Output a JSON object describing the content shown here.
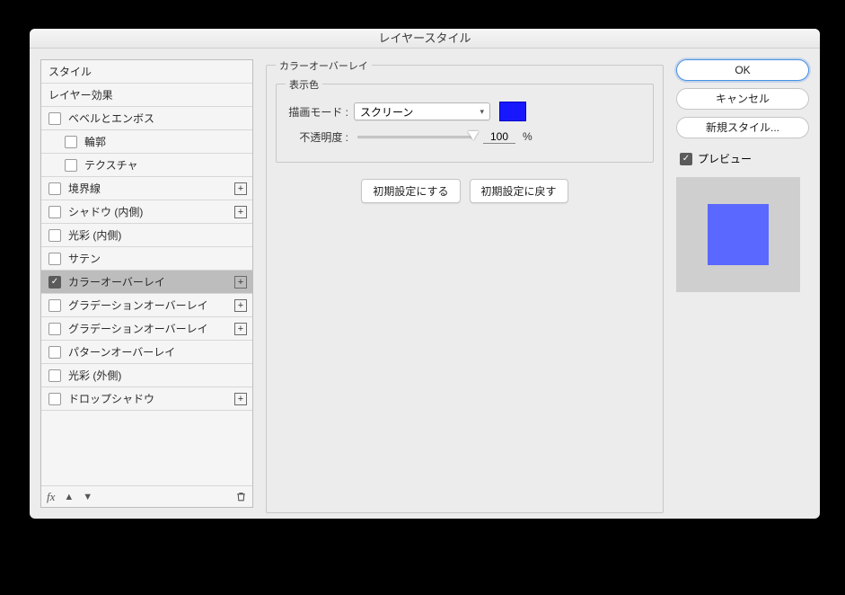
{
  "window": {
    "title": "レイヤースタイル"
  },
  "sidebar": {
    "header_styles": "スタイル",
    "header_effects": "レイヤー効果",
    "items": [
      {
        "label": "ベベルとエンボス",
        "checked": false,
        "has_add": false,
        "indent": 1
      },
      {
        "label": "輪郭",
        "checked": false,
        "has_add": false,
        "indent": 2
      },
      {
        "label": "テクスチャ",
        "checked": false,
        "has_add": false,
        "indent": 2
      },
      {
        "label": "境界線",
        "checked": false,
        "has_add": true,
        "indent": 1
      },
      {
        "label": "シャドウ (内側)",
        "checked": false,
        "has_add": true,
        "indent": 1
      },
      {
        "label": "光彩 (内側)",
        "checked": false,
        "has_add": false,
        "indent": 1
      },
      {
        "label": "サテン",
        "checked": false,
        "has_add": false,
        "indent": 1
      },
      {
        "label": "カラーオーバーレイ",
        "checked": true,
        "has_add": true,
        "indent": 1,
        "selected": true
      },
      {
        "label": "グラデーションオーバーレイ",
        "checked": false,
        "has_add": true,
        "indent": 1
      },
      {
        "label": "グラデーションオーバーレイ",
        "checked": false,
        "has_add": true,
        "indent": 1
      },
      {
        "label": "パターンオーバーレイ",
        "checked": false,
        "has_add": false,
        "indent": 1
      },
      {
        "label": "光彩 (外側)",
        "checked": false,
        "has_add": false,
        "indent": 1
      },
      {
        "label": "ドロップシャドウ",
        "checked": false,
        "has_add": true,
        "indent": 1
      }
    ],
    "footer": {
      "fx": "fx"
    }
  },
  "center": {
    "group_title": "カラーオーバーレイ",
    "section_title": "表示色",
    "blend_label": "描画モード :",
    "blend_value": "スクリーン",
    "opacity_label": "不透明度 :",
    "opacity_value": "100",
    "opacity_unit": "%",
    "btn_make_default": "初期設定にする",
    "btn_reset_default": "初期設定に戻す",
    "color": "#1818ff"
  },
  "right": {
    "ok": "OK",
    "cancel": "キャンセル",
    "new_style": "新規スタイル...",
    "preview_label": "プレビュー",
    "preview_color": "#5a68ff"
  }
}
